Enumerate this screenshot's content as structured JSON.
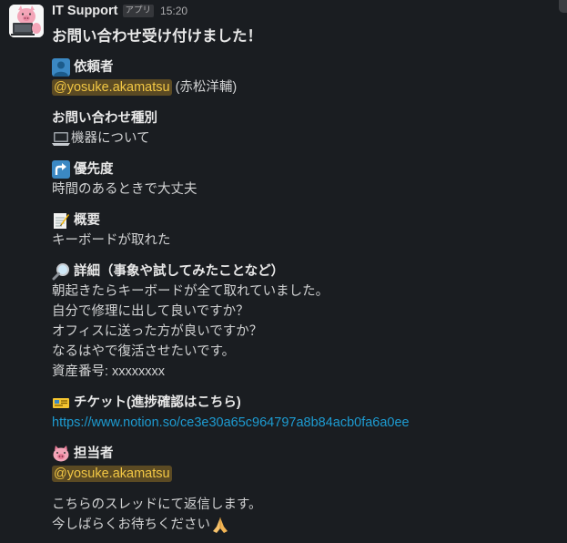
{
  "message": {
    "sender": "IT Support",
    "badge": "アプリ",
    "time": "15:20",
    "avatar_icon": "pig-laptop-icon",
    "title": "お問い合わせ受け付けました！"
  },
  "sections": {
    "requester": {
      "icon": "person-silhouette-icon",
      "heading": "依頼者",
      "mention": "@yosuke.akamatsu",
      "name": "(赤松洋輔)"
    },
    "type": {
      "heading": "お問い合わせ種別",
      "icon": "laptop-icon",
      "value": "機器について"
    },
    "priority": {
      "icon": "arrow-up-icon",
      "heading": "優先度",
      "value": "時間のあるときで大丈夫"
    },
    "summary": {
      "icon": "memo-icon",
      "heading": "概要",
      "value": "キーボードが取れた"
    },
    "details": {
      "icon": "magnifier-icon",
      "heading": "詳細（事象や試してみたことなど）",
      "lines": [
        "朝起きたらキーボードが全て取れていました。",
        "自分で修理に出して良いですか？",
        "オフィスに送った方が良いですか？",
        "なるはやで復活させたいです。",
        "資産番号: xxxxxxxx"
      ]
    },
    "ticket": {
      "icon": "ticket-icon",
      "heading": "チケット(進捗確認はこちら)",
      "url": "https://www.notion.so/ce3e30a65c964797a8b84acb0fa6a0ee"
    },
    "assignee": {
      "icon": "pig-face-icon",
      "heading": "担当者",
      "mention": "@yosuke.akamatsu"
    },
    "footer": {
      "line1": "こちらのスレッドにて返信します。",
      "line2": "今しばらくお待ちください",
      "end_icon": "folded-hands-icon"
    }
  },
  "colors": {
    "background": "#1a1d21",
    "mention_bg": "#5b4a23",
    "mention_text": "#f2c744",
    "link": "#1d9bd1"
  }
}
